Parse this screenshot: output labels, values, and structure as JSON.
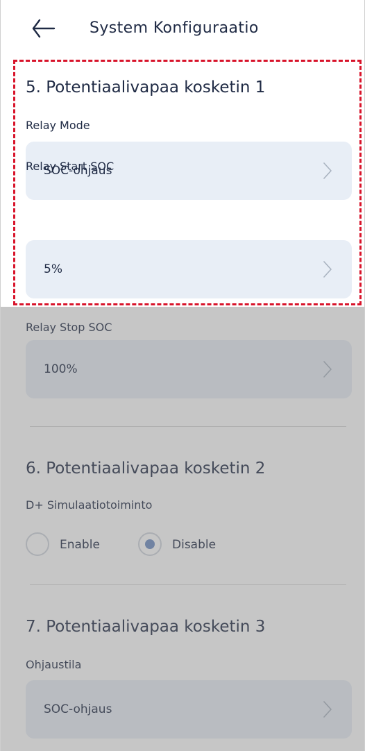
{
  "header": {
    "title": "System  Konfiguraatio",
    "back_icon": "arrow-left-icon"
  },
  "sections": [
    {
      "title": "5. Potentiaalivapaa kosketin 1",
      "fields": [
        {
          "label": "Relay Mode",
          "value": "SOC-ohjaus"
        },
        {
          "label": "Relay Start SOC",
          "value": "5%"
        },
        {
          "label": "Relay Stop SOC",
          "value": "100%"
        }
      ]
    },
    {
      "title": "6. Potentiaalivapaa kosketin 2",
      "field_label": "D+ Simulaatiotoiminto",
      "options": [
        {
          "label": "Enable",
          "selected": false
        },
        {
          "label": "Disable",
          "selected": true
        }
      ]
    },
    {
      "title": "7. Potentiaalivapaa kosketin 3",
      "field_label": "Ohjaustila",
      "value": "SOC-ohjaus"
    }
  ],
  "colors": {
    "text": "#1f2a44",
    "select_bg": "#e8eef6",
    "radio_active": "#6d8cc2",
    "highlight": "#d8132a"
  }
}
